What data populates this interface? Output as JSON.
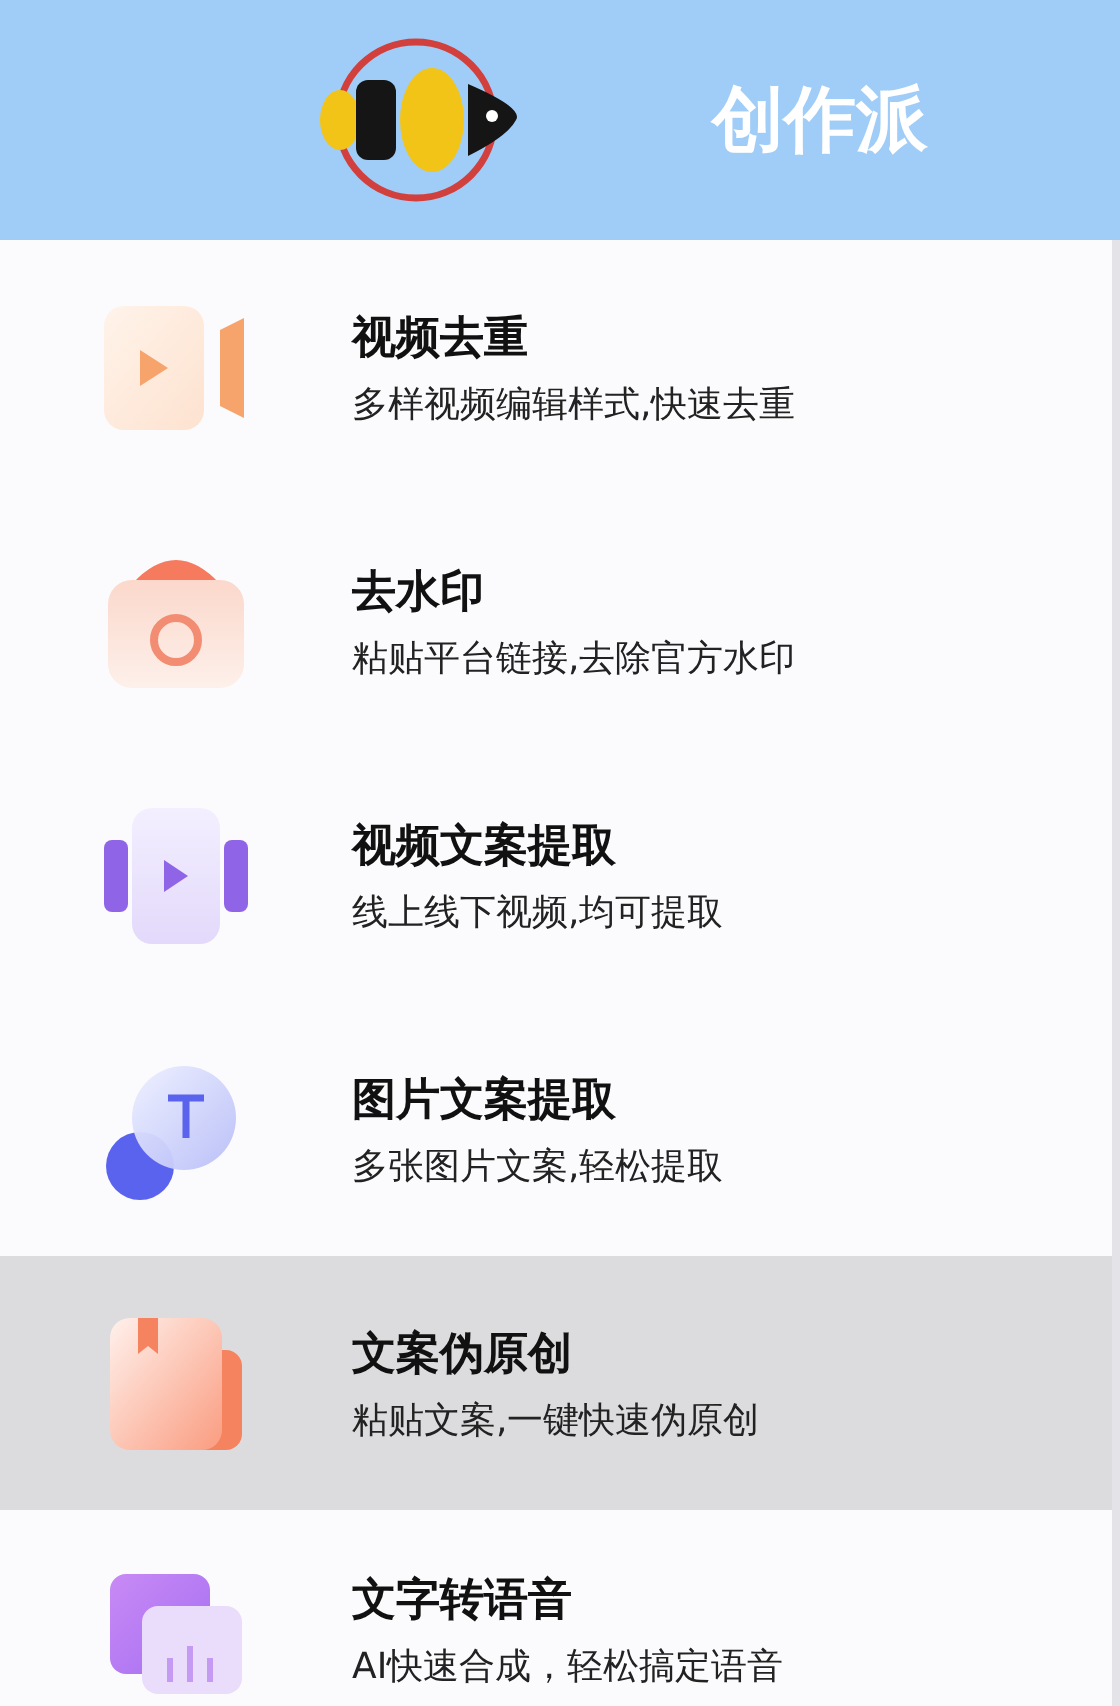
{
  "header": {
    "title": "创作派"
  },
  "tools": [
    {
      "title": "视频去重",
      "subtitle": "多样视频编辑样式,快速去重",
      "selected": false
    },
    {
      "title": "去水印",
      "subtitle": "粘贴平台链接,去除官方水印",
      "selected": false
    },
    {
      "title": "视频文案提取",
      "subtitle": "线上线下视频,均可提取",
      "selected": false
    },
    {
      "title": "图片文案提取",
      "subtitle": "多张图片文案,轻松提取",
      "selected": false
    },
    {
      "title": "文案伪原创",
      "subtitle": "粘贴文案,一键快速伪原创",
      "selected": true
    },
    {
      "title": "文字转语音",
      "subtitle": "AI快速合成，轻松搞定语音",
      "selected": false
    }
  ]
}
